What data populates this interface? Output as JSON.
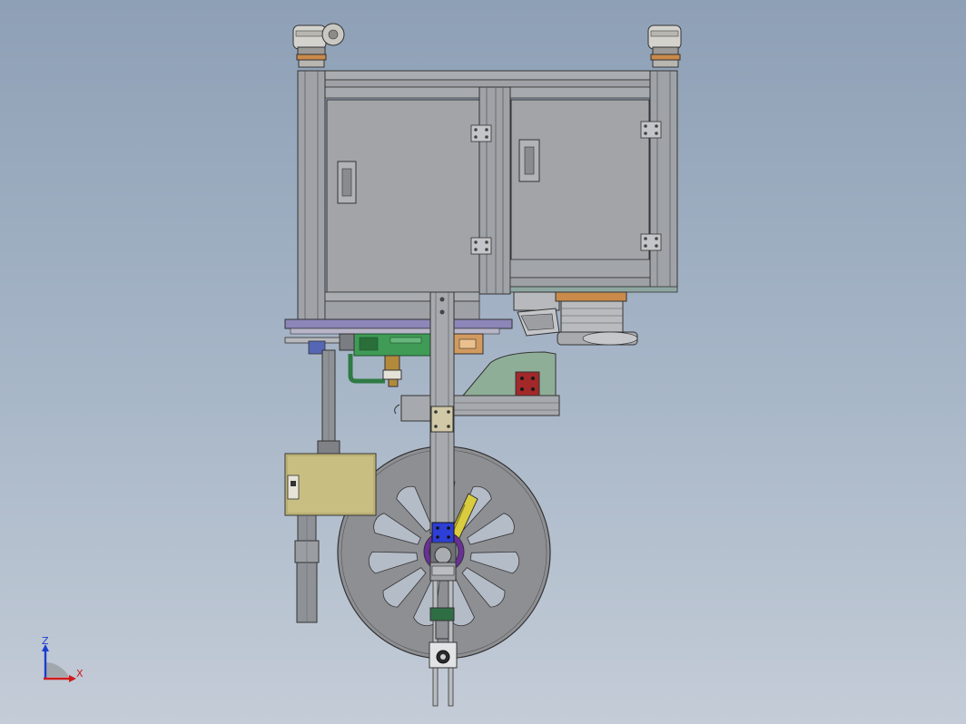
{
  "triad": {
    "z_label": "Z",
    "x_label": "X",
    "z_color": "#1a3fd0",
    "x_color": "#d01a1a"
  },
  "colors": {
    "frame": "#9a9ea4",
    "panel": "#a2a4a8",
    "edge": "#3a3a3a",
    "base_plate": "#8d86b8",
    "pcb_green": "#3f9b55",
    "control_box": "#c9be82",
    "wheel": "#8e8f93",
    "guard_green": "#8fae98",
    "blue_block": "#2d3fd6",
    "purple_ring": "#6a2f9a",
    "yellow_arm": "#d9cc3e",
    "red_block": "#a3282a"
  }
}
